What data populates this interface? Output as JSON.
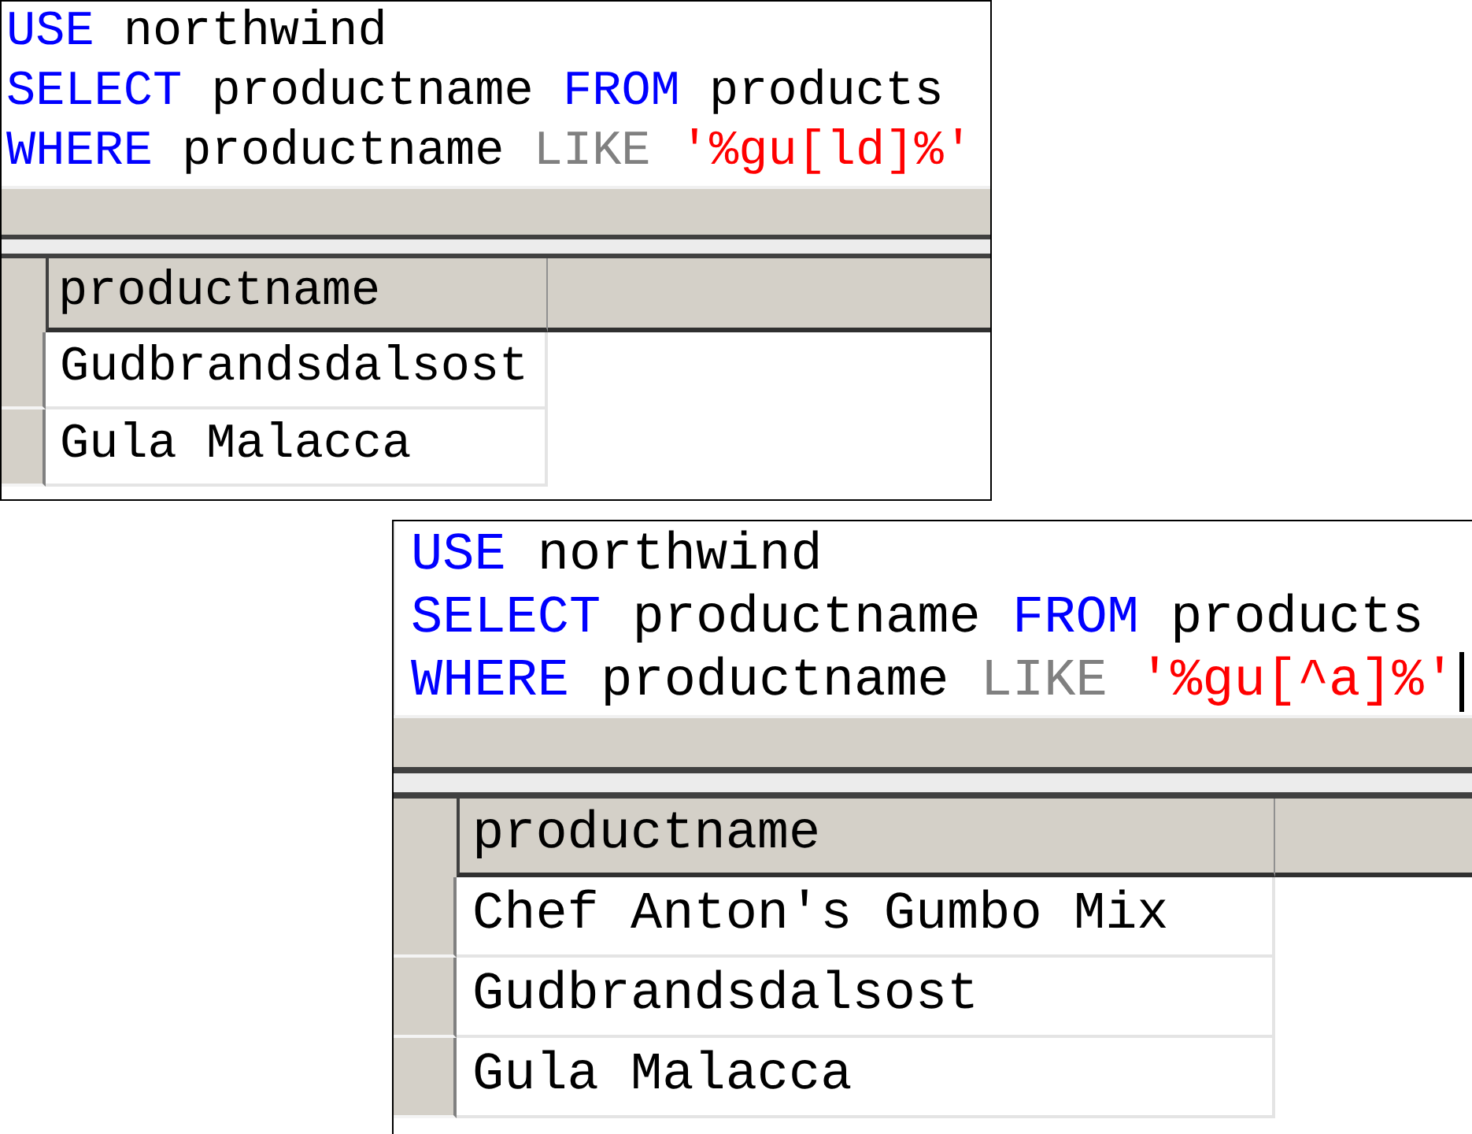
{
  "panels": [
    {
      "editor": {
        "lines": [
          {
            "tokens": [
              {
                "kind": "keyword",
                "text": "USE"
              },
              {
                "kind": "plain",
                "text": "northwind"
              }
            ]
          },
          {
            "tokens": [
              {
                "kind": "keyword",
                "text": "SELECT"
              },
              {
                "kind": "plain",
                "text": "productname"
              },
              {
                "kind": "keyword",
                "text": "FROM"
              },
              {
                "kind": "plain",
                "text": "products"
              }
            ]
          },
          {
            "tokens": [
              {
                "kind": "keyword",
                "text": "WHERE"
              },
              {
                "kind": "plain",
                "text": "productname"
              },
              {
                "kind": "operator",
                "text": "LIKE"
              },
              {
                "kind": "string",
                "text": "'%gu[ld]%'"
              }
            ]
          }
        ],
        "caret": false
      },
      "results": {
        "columns": [
          "productname"
        ],
        "rows": [
          [
            "Gudbrandsdalsost"
          ],
          [
            "Gula Malacca"
          ]
        ]
      }
    },
    {
      "editor": {
        "lines": [
          {
            "tokens": [
              {
                "kind": "keyword",
                "text": "USE"
              },
              {
                "kind": "plain",
                "text": "northwind"
              }
            ]
          },
          {
            "tokens": [
              {
                "kind": "keyword",
                "text": "SELECT"
              },
              {
                "kind": "plain",
                "text": "productname"
              },
              {
                "kind": "keyword",
                "text": "FROM"
              },
              {
                "kind": "plain",
                "text": "products"
              }
            ]
          },
          {
            "tokens": [
              {
                "kind": "keyword",
                "text": "WHERE"
              },
              {
                "kind": "plain",
                "text": "productname"
              },
              {
                "kind": "operator",
                "text": "LIKE"
              },
              {
                "kind": "string",
                "text": "'%gu[^a]%'"
              }
            ]
          }
        ],
        "caret": true
      },
      "results": {
        "columns": [
          "productname"
        ],
        "rows": [
          [
            "Chef Anton's Gumbo Mix"
          ],
          [
            "Gudbrandsdalsost"
          ],
          [
            "Gula Malacca"
          ]
        ]
      }
    }
  ]
}
